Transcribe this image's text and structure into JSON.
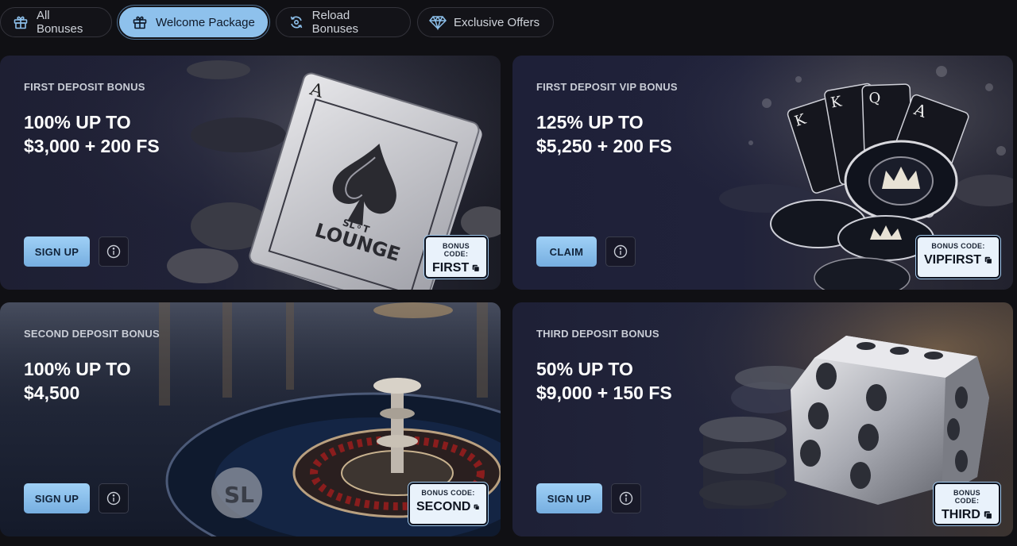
{
  "tabs": [
    {
      "label": "All Bonuses",
      "icon": "gift-icon",
      "active": false
    },
    {
      "label": "Welcome Package",
      "icon": "gift-icon",
      "active": true
    },
    {
      "label": "Reload Bonuses",
      "icon": "reload-icon",
      "active": false
    },
    {
      "label": "Exclusive Offers",
      "icon": "diamond-icon",
      "active": false
    }
  ],
  "cards": [
    {
      "eyebrow": "FIRST DEPOSIT BONUS",
      "line1": "100% UP TO",
      "line2": "$3,000 + 200 FS",
      "cta": "SIGN UP",
      "code_label": "BONUS CODE:",
      "code": "FIRST",
      "art": "playing-cards-slot-lounge",
      "logo_text": "SLOT LOUNGE"
    },
    {
      "eyebrow": "FIRST DEPOSIT VIP BONUS",
      "line1": "125% UP TO",
      "line2": "$5,250 + 200 FS",
      "cta": "CLAIM",
      "code_label": "BONUS CODE:",
      "code": "VIPFIRST",
      "art": "royal-cards-and-chips"
    },
    {
      "eyebrow": "SECOND DEPOSIT BONUS",
      "line1": "100% UP TO",
      "line2": "$4,500",
      "cta": "SIGN UP",
      "code_label": "BONUS CODE:",
      "code": "SECOND",
      "art": "roulette-wheel"
    },
    {
      "eyebrow": "THIRD DEPOSIT BONUS",
      "line1": "50% UP TO",
      "line2": "$9,000 + 150 FS",
      "cta": "SIGN UP",
      "code_label": "BONUS CODE:",
      "code": "THIRD",
      "art": "chrome-dice"
    }
  ],
  "colors": {
    "page_bg": "#101014",
    "accent": "#8ec1ec",
    "button_text": "#11233a"
  }
}
